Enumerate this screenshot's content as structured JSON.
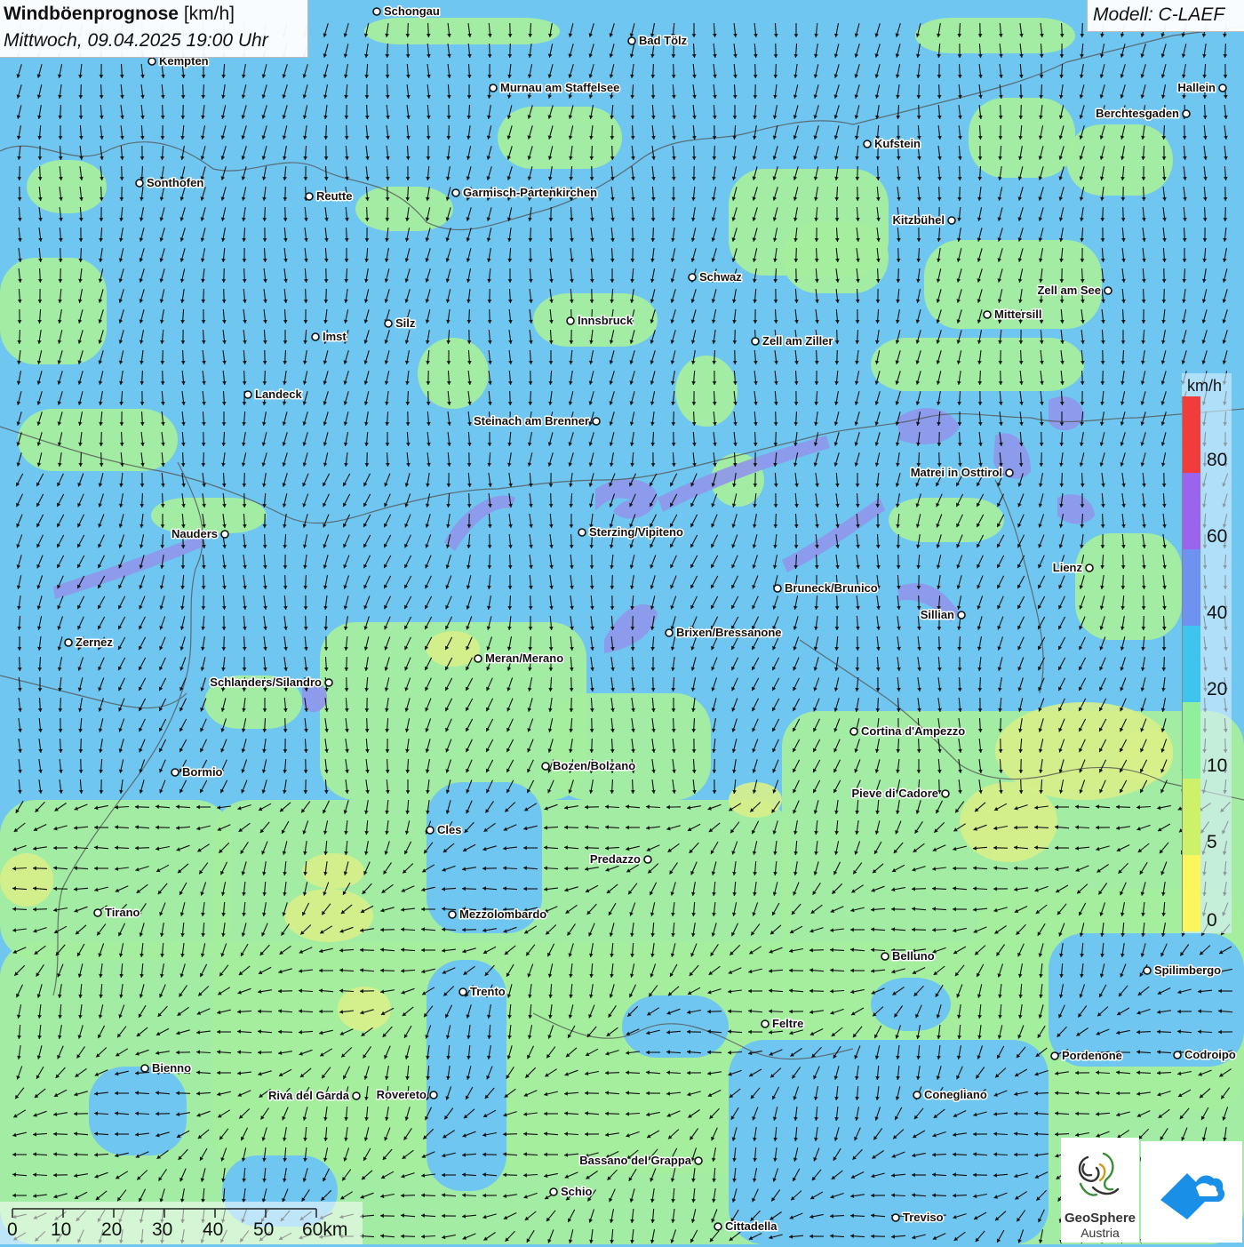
{
  "title": {
    "main": "Windböenprognose",
    "unit": "[km/h]",
    "datetime": "Mittwoch, 09.04.2025 19:00 Uhr"
  },
  "model": "Modell: C-LAEF",
  "legend": {
    "unit": "km/h",
    "labels": [
      "80",
      "60",
      "40",
      "20",
      "10",
      "5",
      "0"
    ],
    "colors": [
      "#f23b3b",
      "#9b64ec",
      "#6d92ef",
      "#3fc4f0",
      "#8fef9a",
      "#cdf26a",
      "#fbf65e"
    ]
  },
  "scale": {
    "labels": [
      "0",
      "10",
      "20",
      "30",
      "40",
      "50",
      "60km"
    ]
  },
  "logos": {
    "geosphere_name": "GeoSphere",
    "geosphere_sub": "Austria"
  },
  "colors": {
    "blue_zone": "#6fc6f0",
    "green_zone": "#a4ee9e",
    "yellow_zone": "#d8f08a",
    "purple_zone": "#8f96ea",
    "arrow": "#111111",
    "border": "#555555"
  },
  "cities": [
    {
      "name": "Schongau"
    },
    {
      "name": "Bad Tölz"
    },
    {
      "name": "Kempten"
    },
    {
      "name": "Murnau am Staffelsee"
    },
    {
      "name": "Hallein"
    },
    {
      "name": "Berchtesgaden"
    },
    {
      "name": "Kufstein"
    },
    {
      "name": "Sonthofen"
    },
    {
      "name": "Reutte"
    },
    {
      "name": "Garmisch-Partenkirchen"
    },
    {
      "name": "Kitzbühel"
    },
    {
      "name": "Schwaz"
    },
    {
      "name": "Zell am See"
    },
    {
      "name": "Mittersill"
    },
    {
      "name": "Innsbruck"
    },
    {
      "name": "Silz"
    },
    {
      "name": "Imst"
    },
    {
      "name": "Zell am Ziller"
    },
    {
      "name": "Landeck"
    },
    {
      "name": "Steinach am Brenner"
    },
    {
      "name": "Matrei in Osttirol"
    },
    {
      "name": "Nauders"
    },
    {
      "name": "Sterzing/Vipiteno"
    },
    {
      "name": "Lienz"
    },
    {
      "name": "Bruneck/Brunico"
    },
    {
      "name": "Sillian"
    },
    {
      "name": "Brixen/Bressanone"
    },
    {
      "name": "Zernez"
    },
    {
      "name": "Meran/Merano"
    },
    {
      "name": "Schlanders/Silandro"
    },
    {
      "name": "Cortina d'Ampezzo"
    },
    {
      "name": "Bozen/Bolzano"
    },
    {
      "name": "Bormio"
    },
    {
      "name": "Pieve di Cadore"
    },
    {
      "name": "Cles"
    },
    {
      "name": "Predazzo"
    },
    {
      "name": "Tirano"
    },
    {
      "name": "Mezzolombardo"
    },
    {
      "name": "Belluno"
    },
    {
      "name": "Spilimbergo"
    },
    {
      "name": "Trento"
    },
    {
      "name": "Feltre"
    },
    {
      "name": "Pordenone"
    },
    {
      "name": "Codroipo"
    },
    {
      "name": "Bienno"
    },
    {
      "name": "Riva del Garda"
    },
    {
      "name": "Rovereto"
    },
    {
      "name": "Conegliano"
    },
    {
      "name": "Bassano del Grappa"
    },
    {
      "name": "Schio"
    },
    {
      "name": "Treviso"
    },
    {
      "name": "Cittadella"
    }
  ]
}
